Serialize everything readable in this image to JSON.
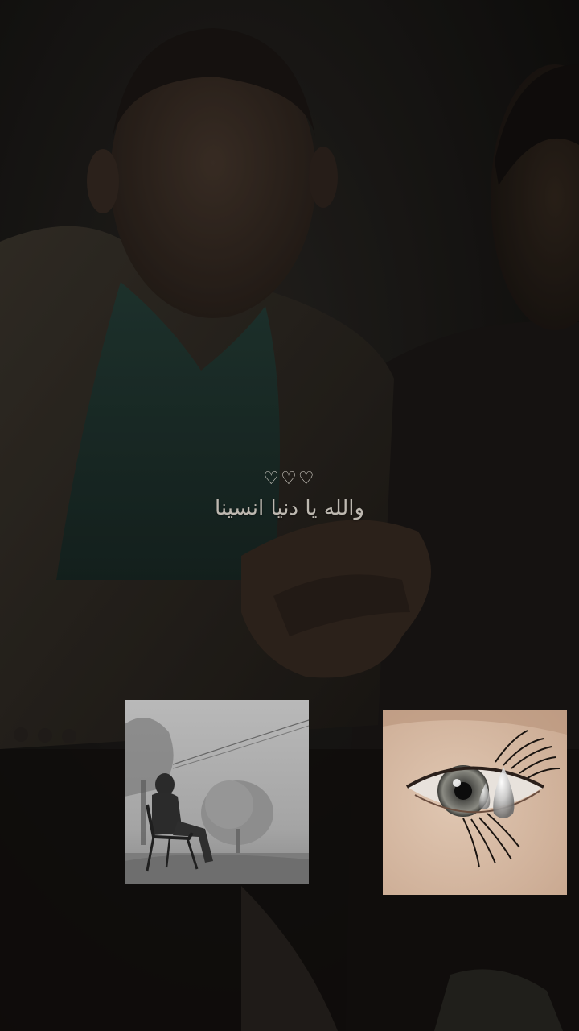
{
  "overlay": {
    "hearts": "♡♡♡",
    "caption": "والله يا دنيا انسينا"
  },
  "colors": {
    "background": "#141311",
    "caption": "#bdb8b0"
  },
  "images": [
    {
      "name": "fog-tree-chair-photo"
    },
    {
      "name": "teary-eye-photo"
    }
  ]
}
